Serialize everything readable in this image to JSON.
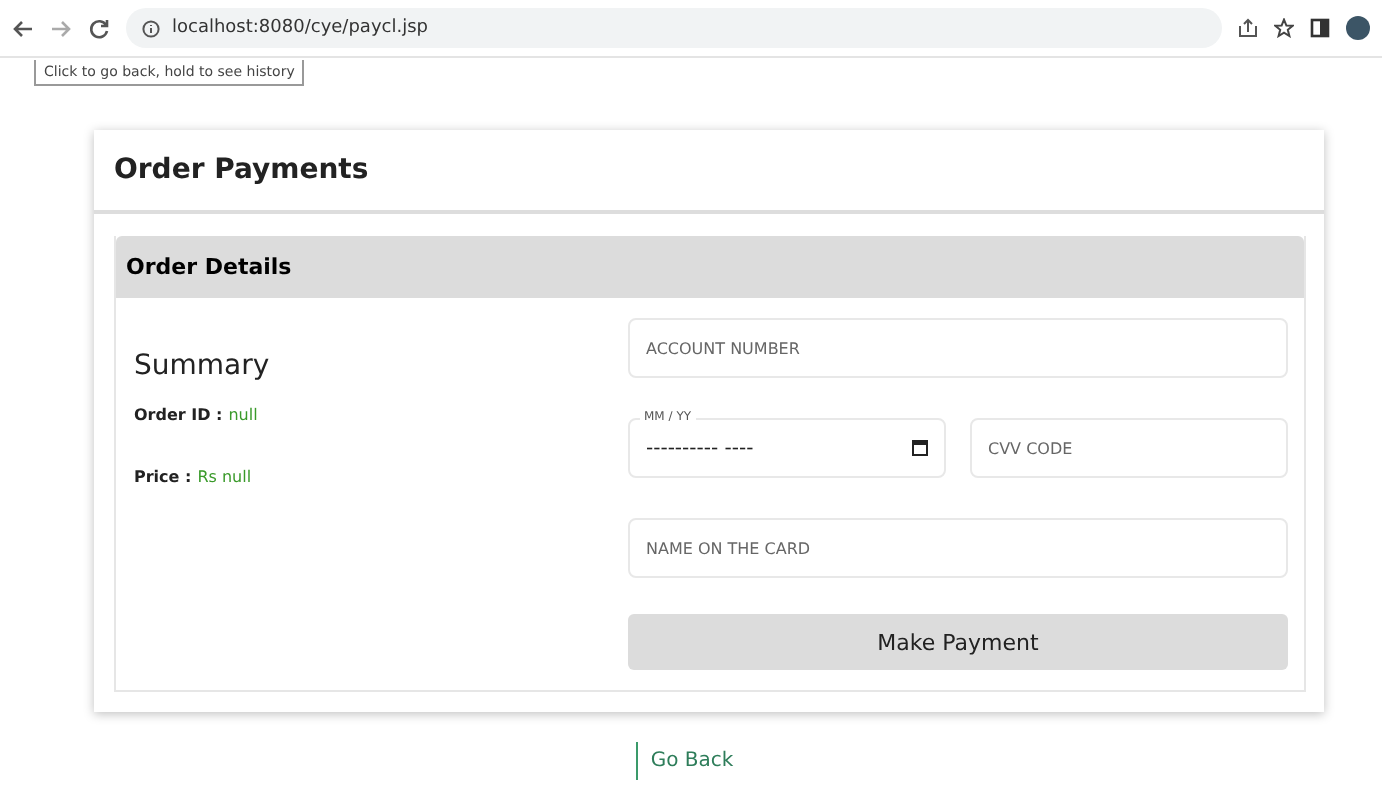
{
  "browser": {
    "url": "localhost:8080/cye/paycl.jsp",
    "tooltip": "Click to go back, hold to see history"
  },
  "card": {
    "title": "Order Payments",
    "section_title": "Order Details",
    "summary": {
      "heading": "Summary",
      "fields": [
        {
          "label": "Order ID :",
          "value": "null"
        },
        {
          "label": "Price :",
          "value": "Rs null"
        }
      ]
    },
    "form": {
      "account_placeholder": "ACCOUNT NUMBER",
      "expiry_label": "MM / YY",
      "expiry_value": "---------- ----",
      "cvv_placeholder": "CVV CODE",
      "name_placeholder": "NAME ON THE CARD",
      "submit": "Make Payment"
    }
  },
  "go_back": "Go Back"
}
